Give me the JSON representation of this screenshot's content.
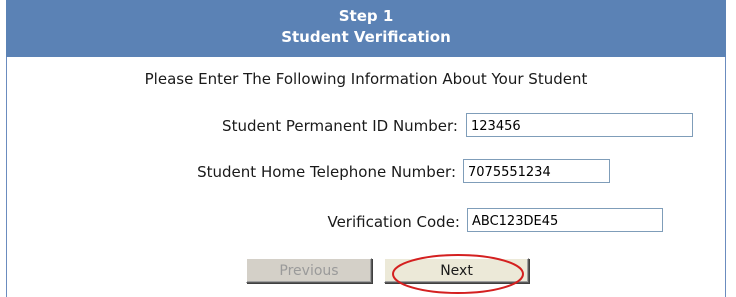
{
  "header": {
    "step": "Step 1",
    "title": "Student Verification"
  },
  "intro": "Please Enter The Following Information About Your Student",
  "fields": {
    "permanent_id": {
      "label": "Student Permanent ID Number:",
      "value": "123456"
    },
    "home_phone": {
      "label": "Student Home Telephone Number:",
      "value": "7075551234"
    },
    "verification_code": {
      "label": "Verification Code:",
      "value": "ABC123DE45"
    }
  },
  "buttons": {
    "previous": "Previous",
    "next": "Next"
  },
  "colors": {
    "header_bg": "#5b82b5",
    "annotation": "#d42020"
  }
}
